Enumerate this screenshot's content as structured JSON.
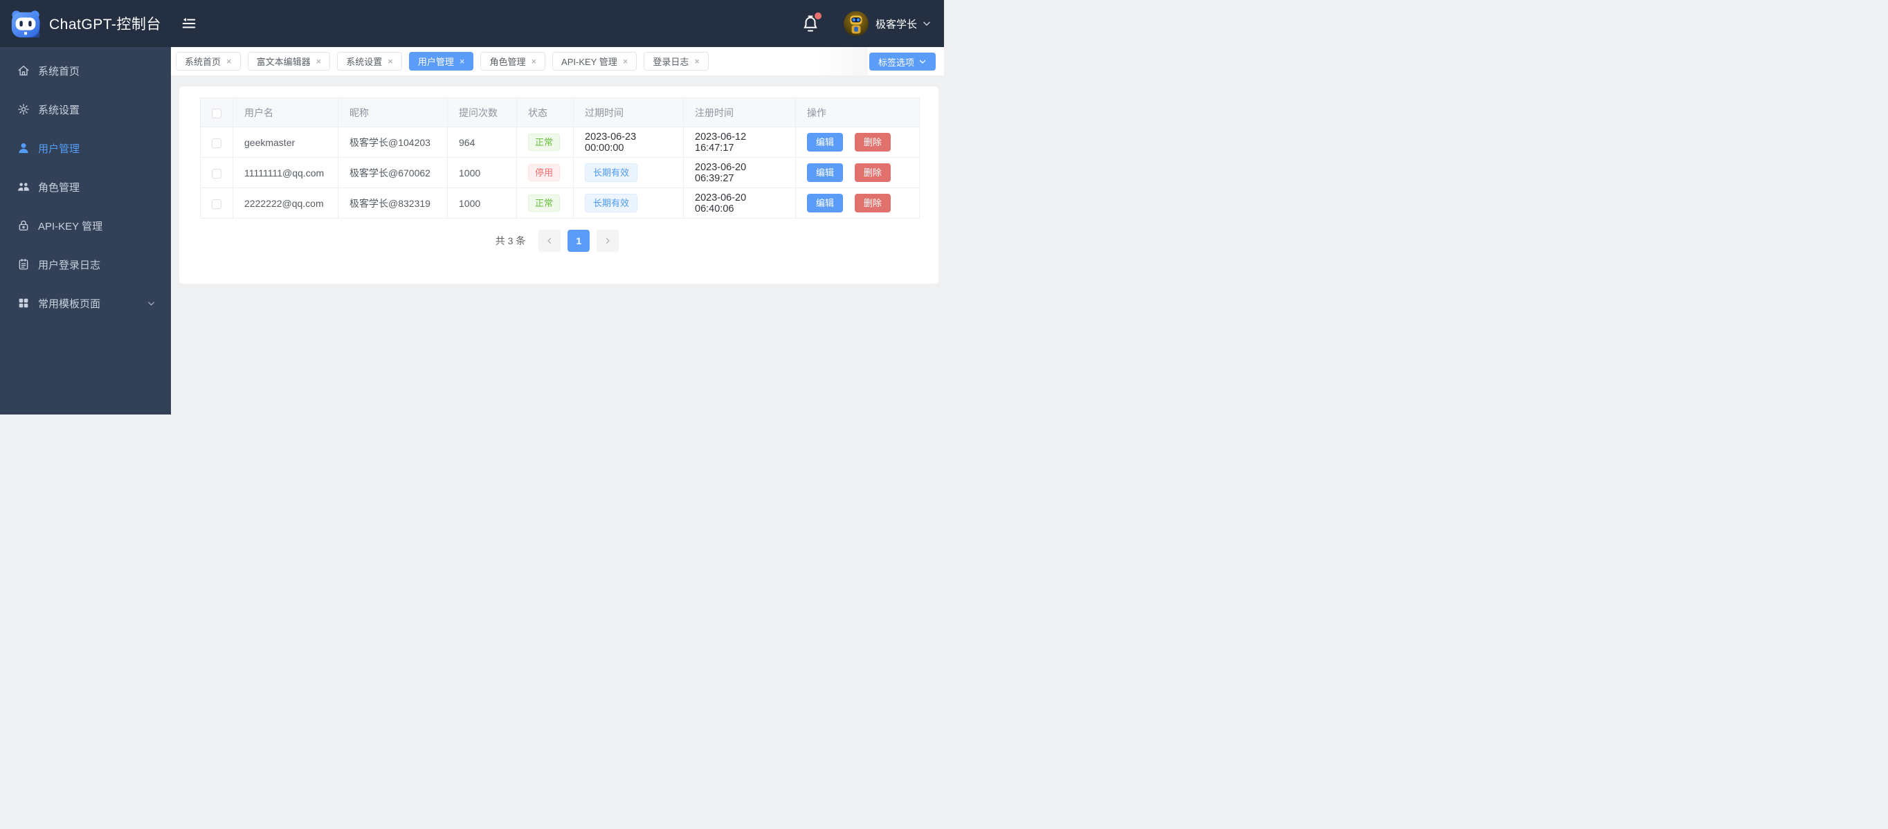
{
  "header": {
    "app_title": "ChatGPT-控制台",
    "user": {
      "name": "极客学长"
    }
  },
  "sidebar": {
    "items": [
      {
        "label": "系统首页"
      },
      {
        "label": "系统设置"
      },
      {
        "label": "用户管理"
      },
      {
        "label": "角色管理"
      },
      {
        "label": "API-KEY 管理"
      },
      {
        "label": "用户登录日志"
      },
      {
        "label": "常用模板页面"
      }
    ]
  },
  "tabbar": {
    "close_glyph": "×",
    "tabs": [
      {
        "label": "系统首页"
      },
      {
        "label": "富文本编辑器"
      },
      {
        "label": "系统设置"
      },
      {
        "label": "用户管理"
      },
      {
        "label": "角色管理"
      },
      {
        "label": "API-KEY 管理"
      },
      {
        "label": "登录日志"
      }
    ],
    "options_button_label": "标签选项"
  },
  "table": {
    "columns": [
      "用户名",
      "昵称",
      "提问次数",
      "状态",
      "过期时间",
      "注册时间",
      "操作"
    ],
    "rows": [
      {
        "username": "geekmaster",
        "nickname": "极客学长@104203",
        "count": "964",
        "status": "正常",
        "expire": "2023-06-23 00:00:00",
        "registered": "2023-06-12 16:47:17",
        "edit_label": "编辑",
        "delete_label": "删除"
      },
      {
        "username": "11111111@qq.com",
        "nickname": "极客学长@670062",
        "count": "1000",
        "status": "停用",
        "expire": "长期有效",
        "registered": "2023-06-20 06:39:27",
        "edit_label": "编辑",
        "delete_label": "删除"
      },
      {
        "username": "2222222@qq.com",
        "nickname": "极客学长@832319",
        "count": "1000",
        "status": "正常",
        "expire": "长期有效",
        "registered": "2023-06-20 06:40:06",
        "edit_label": "编辑",
        "delete_label": "删除"
      }
    ]
  },
  "pagination": {
    "total_label": "共 3 条",
    "current_page": "1"
  },
  "colors": {
    "primary": "#5a9cf8",
    "danger_button": "#e0716d",
    "header_bg": "#242f42",
    "sidebar_bg": "#324157",
    "tag_success_text": "#67c23a",
    "tag_danger_text": "#f56c6c",
    "tag_blue_text": "#4f9bf5"
  }
}
